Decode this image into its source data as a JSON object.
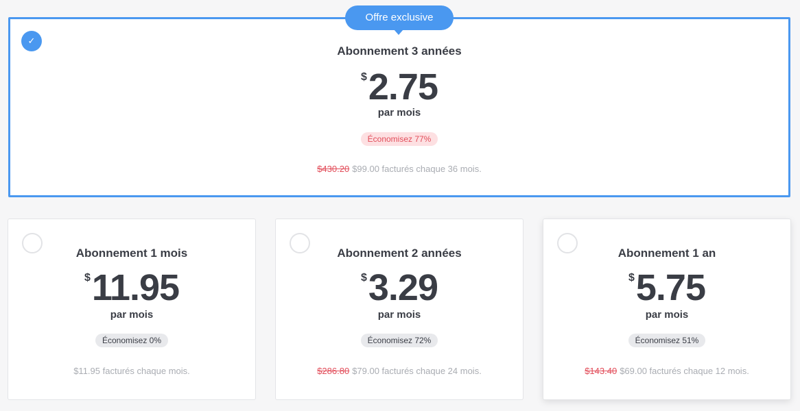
{
  "exclusive_badge": "Offre exclusive",
  "icons": {
    "selected": "check-icon"
  },
  "colors": {
    "accent": "#4a98f0",
    "discount_red": "#e24d5a"
  },
  "featured": {
    "title": "Abonnement 3 années",
    "currency": "$",
    "price": "2.75",
    "per": "par mois",
    "save": "Économisez  77%",
    "old_price": "$430.20",
    "billing": "$99.00  facturés chaque 36 mois."
  },
  "plans": [
    {
      "title": "Abonnement 1 mois",
      "currency": "$",
      "price": "11.95",
      "per": "par mois",
      "save": "Économisez 0%",
      "old_price": "",
      "billing": "$11.95 facturés chaque mois."
    },
    {
      "title": "Abonnement 2 années",
      "currency": "$",
      "price": "3.29",
      "per": "par mois",
      "save": "Économisez 72%",
      "old_price": "$286.80",
      "billing": "$79.00 facturés chaque 24 mois."
    },
    {
      "title": "Abonnement 1 an",
      "currency": "$",
      "price": "5.75",
      "per": "par mois",
      "save": "Économisez 51%",
      "old_price": "$143.40",
      "billing": "$69.00 facturés chaque 12 mois."
    }
  ]
}
